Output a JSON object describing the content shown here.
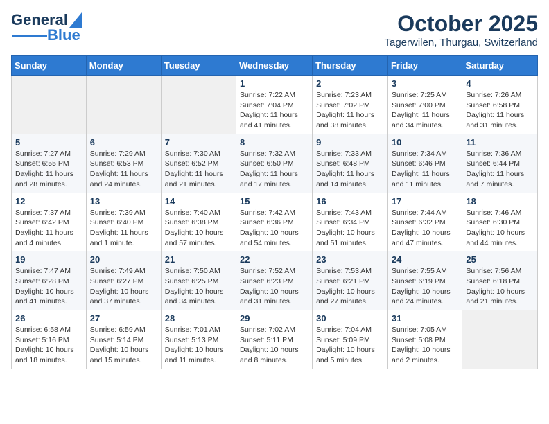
{
  "header": {
    "logo_general": "General",
    "logo_blue": "Blue",
    "title": "October 2025",
    "subtitle": "Tagerwilen, Thurgau, Switzerland"
  },
  "weekdays": [
    "Sunday",
    "Monday",
    "Tuesday",
    "Wednesday",
    "Thursday",
    "Friday",
    "Saturday"
  ],
  "weeks": [
    [
      {
        "day": "",
        "info": ""
      },
      {
        "day": "",
        "info": ""
      },
      {
        "day": "",
        "info": ""
      },
      {
        "day": "1",
        "info": "Sunrise: 7:22 AM\nSunset: 7:04 PM\nDaylight: 11 hours\nand 41 minutes."
      },
      {
        "day": "2",
        "info": "Sunrise: 7:23 AM\nSunset: 7:02 PM\nDaylight: 11 hours\nand 38 minutes."
      },
      {
        "day": "3",
        "info": "Sunrise: 7:25 AM\nSunset: 7:00 PM\nDaylight: 11 hours\nand 34 minutes."
      },
      {
        "day": "4",
        "info": "Sunrise: 7:26 AM\nSunset: 6:58 PM\nDaylight: 11 hours\nand 31 minutes."
      }
    ],
    [
      {
        "day": "5",
        "info": "Sunrise: 7:27 AM\nSunset: 6:55 PM\nDaylight: 11 hours\nand 28 minutes."
      },
      {
        "day": "6",
        "info": "Sunrise: 7:29 AM\nSunset: 6:53 PM\nDaylight: 11 hours\nand 24 minutes."
      },
      {
        "day": "7",
        "info": "Sunrise: 7:30 AM\nSunset: 6:52 PM\nDaylight: 11 hours\nand 21 minutes."
      },
      {
        "day": "8",
        "info": "Sunrise: 7:32 AM\nSunset: 6:50 PM\nDaylight: 11 hours\nand 17 minutes."
      },
      {
        "day": "9",
        "info": "Sunrise: 7:33 AM\nSunset: 6:48 PM\nDaylight: 11 hours\nand 14 minutes."
      },
      {
        "day": "10",
        "info": "Sunrise: 7:34 AM\nSunset: 6:46 PM\nDaylight: 11 hours\nand 11 minutes."
      },
      {
        "day": "11",
        "info": "Sunrise: 7:36 AM\nSunset: 6:44 PM\nDaylight: 11 hours\nand 7 minutes."
      }
    ],
    [
      {
        "day": "12",
        "info": "Sunrise: 7:37 AM\nSunset: 6:42 PM\nDaylight: 11 hours\nand 4 minutes."
      },
      {
        "day": "13",
        "info": "Sunrise: 7:39 AM\nSunset: 6:40 PM\nDaylight: 11 hours\nand 1 minute."
      },
      {
        "day": "14",
        "info": "Sunrise: 7:40 AM\nSunset: 6:38 PM\nDaylight: 10 hours\nand 57 minutes."
      },
      {
        "day": "15",
        "info": "Sunrise: 7:42 AM\nSunset: 6:36 PM\nDaylight: 10 hours\nand 54 minutes."
      },
      {
        "day": "16",
        "info": "Sunrise: 7:43 AM\nSunset: 6:34 PM\nDaylight: 10 hours\nand 51 minutes."
      },
      {
        "day": "17",
        "info": "Sunrise: 7:44 AM\nSunset: 6:32 PM\nDaylight: 10 hours\nand 47 minutes."
      },
      {
        "day": "18",
        "info": "Sunrise: 7:46 AM\nSunset: 6:30 PM\nDaylight: 10 hours\nand 44 minutes."
      }
    ],
    [
      {
        "day": "19",
        "info": "Sunrise: 7:47 AM\nSunset: 6:28 PM\nDaylight: 10 hours\nand 41 minutes."
      },
      {
        "day": "20",
        "info": "Sunrise: 7:49 AM\nSunset: 6:27 PM\nDaylight: 10 hours\nand 37 minutes."
      },
      {
        "day": "21",
        "info": "Sunrise: 7:50 AM\nSunset: 6:25 PM\nDaylight: 10 hours\nand 34 minutes."
      },
      {
        "day": "22",
        "info": "Sunrise: 7:52 AM\nSunset: 6:23 PM\nDaylight: 10 hours\nand 31 minutes."
      },
      {
        "day": "23",
        "info": "Sunrise: 7:53 AM\nSunset: 6:21 PM\nDaylight: 10 hours\nand 27 minutes."
      },
      {
        "day": "24",
        "info": "Sunrise: 7:55 AM\nSunset: 6:19 PM\nDaylight: 10 hours\nand 24 minutes."
      },
      {
        "day": "25",
        "info": "Sunrise: 7:56 AM\nSunset: 6:18 PM\nDaylight: 10 hours\nand 21 minutes."
      }
    ],
    [
      {
        "day": "26",
        "info": "Sunrise: 6:58 AM\nSunset: 5:16 PM\nDaylight: 10 hours\nand 18 minutes."
      },
      {
        "day": "27",
        "info": "Sunrise: 6:59 AM\nSunset: 5:14 PM\nDaylight: 10 hours\nand 15 minutes."
      },
      {
        "day": "28",
        "info": "Sunrise: 7:01 AM\nSunset: 5:13 PM\nDaylight: 10 hours\nand 11 minutes."
      },
      {
        "day": "29",
        "info": "Sunrise: 7:02 AM\nSunset: 5:11 PM\nDaylight: 10 hours\nand 8 minutes."
      },
      {
        "day": "30",
        "info": "Sunrise: 7:04 AM\nSunset: 5:09 PM\nDaylight: 10 hours\nand 5 minutes."
      },
      {
        "day": "31",
        "info": "Sunrise: 7:05 AM\nSunset: 5:08 PM\nDaylight: 10 hours\nand 2 minutes."
      },
      {
        "day": "",
        "info": ""
      }
    ]
  ]
}
